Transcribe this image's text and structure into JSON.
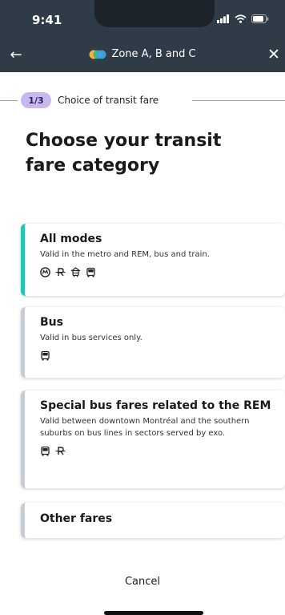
{
  "status_bar": {
    "time": "9:41"
  },
  "nav": {
    "zone_title": "Zone A, B and C",
    "back_icon": "arrow-left-icon",
    "close_icon": "close-icon"
  },
  "step": {
    "badge": "1/3",
    "label": "Choice of transit fare"
  },
  "page_title": "Choose your transit fare category",
  "cards": [
    {
      "title": "All modes",
      "description": "Valid in the metro and REM,  bus and train.",
      "icons": [
        "metro-icon",
        "rem-icon",
        "train-icon",
        "bus-icon"
      ],
      "selected": true
    },
    {
      "title": "Bus",
      "description": "Valid in bus services only.",
      "icons": [
        "bus-icon"
      ],
      "selected": false
    },
    {
      "title": "Special bus fares related to the REM",
      "description": "Valid between downtown Montréal and the southern suburbs on bus lines in sectors served by exo.",
      "icons": [
        "bus-icon",
        "rem-icon"
      ],
      "selected": false
    },
    {
      "title": "Other fares",
      "description": "",
      "icons": [],
      "selected": false
    }
  ],
  "cancel_label": "Cancel",
  "colors": {
    "header": "#2f3b47",
    "accent_selected": "#27c4b0",
    "step_badge": "#c9b8f0"
  }
}
